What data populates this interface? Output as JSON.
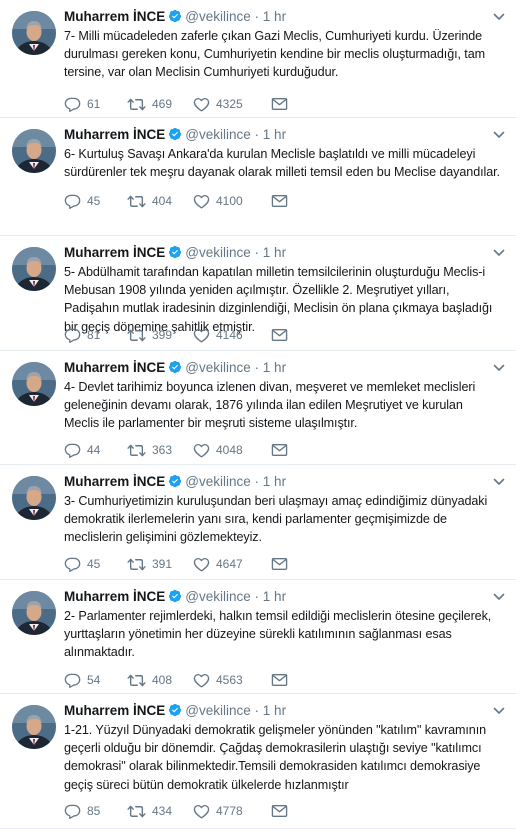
{
  "colors": {
    "verified": "#1da1f2",
    "meta": "#657786",
    "text": "#14171a",
    "divider": "#e6ecf0"
  },
  "icons": {
    "reply": "reply-icon",
    "retweet": "retweet-icon",
    "like": "heart-icon",
    "message": "direct-message-icon",
    "caret": "chevron-down-icon",
    "verified": "verified-badge-icon"
  },
  "tweets": [
    {
      "name": "Muharrem İNCE",
      "handle": "@vekilince",
      "dot": "·",
      "time": "1 hr",
      "text": "7- Milli mücadeleden zaferle çıkan Gazi Meclis, Cumhuriyeti kurdu. Üzerinde durulması gereken konu, Cumhuriyetin kendine bir meclis oluşturmadığı, tam tersine, var olan Meclisin Cumhuriyeti kurduğudur.",
      "replies": "61",
      "retweets": "469",
      "likes": "4325"
    },
    {
      "name": "Muharrem İNCE",
      "handle": "@vekilince",
      "dot": "·",
      "time": "1 hr",
      "text": "6- Kurtuluş Savaşı Ankara'da kurulan Meclisle başlatıldı ve milli mücadeleyi sürdürenler tek meşru dayanak olarak milleti temsil eden bu Meclise dayandılar.",
      "replies": "45",
      "retweets": "404",
      "likes": "4100"
    },
    {
      "name": "Muharrem İNCE",
      "handle": "@vekilince",
      "dot": "·",
      "time": "1 hr",
      "text": "5- Abdülhamit tarafından kapatılan milletin temsilcilerinin oluşturduğu Meclis-i Mebusan 1908 yılında yeniden açılmıştır. Özellikle 2. Meşrutiyet yılları, Padişahın mutlak iradesinin dizginlendiği, Meclisin ön plana çıkmaya başladığı bir geçiş dönemine şahitlik etmiştir.",
      "replies": "81",
      "retweets": "399",
      "likes": "4146"
    },
    {
      "name": "Muharrem İNCE",
      "handle": "@vekilince",
      "dot": "·",
      "time": "1 hr",
      "text": "4- Devlet tarihimiz boyunca izlenen divan, meşveret ve memleket meclisleri geleneğinin devamı olarak, 1876 yılında ilan edilen Meşrutiyet ve kurulan Meclis ile parlamenter bir meşruti sisteme ulaşılmıştır.",
      "replies": "44",
      "retweets": "363",
      "likes": "4048"
    },
    {
      "name": "Muharrem İNCE",
      "handle": "@vekilince",
      "dot": "·",
      "time": "1 hr",
      "text": "3- Cumhuriyetimizin kuruluşundan beri ulaşmayı amaç edindiğimiz dünyadaki demokratik ilerlemelerin yanı sıra, kendi parlamenter geçmişimizde de meclislerin gelişimini gözlemekteyiz.",
      "replies": "45",
      "retweets": "391",
      "likes": "4647"
    },
    {
      "name": "Muharrem İNCE",
      "handle": "@vekilince",
      "dot": "·",
      "time": "1 hr",
      "text": "2- Parlamenter rejimlerdeki, halkın temsil edildiği meclislerin ötesine geçilerek, yurttaşların yönetimin her düzeyine sürekli katılımının sağlanması esas alınmaktadır.",
      "replies": "54",
      "retweets": "408",
      "likes": "4563"
    },
    {
      "name": "Muharrem İNCE",
      "handle": "@vekilince",
      "dot": "·",
      "time": "1 hr",
      "text": "1-21. Yüzyıl Dünyadaki demokratik gelişmeler yönünden \"katılım\" kavramının geçerli olduğu bir dönemdir. Çağdaş demokrasilerin ulaştığı seviye \"katılımcı demokrasi\" olarak bilinmektedir.Temsili demokrasiden katılımcı demokrasiye geçiş süreci bütün demokratik ülkelerde hızlanmıştır",
      "replies": "85",
      "retweets": "434",
      "likes": "4778"
    }
  ]
}
